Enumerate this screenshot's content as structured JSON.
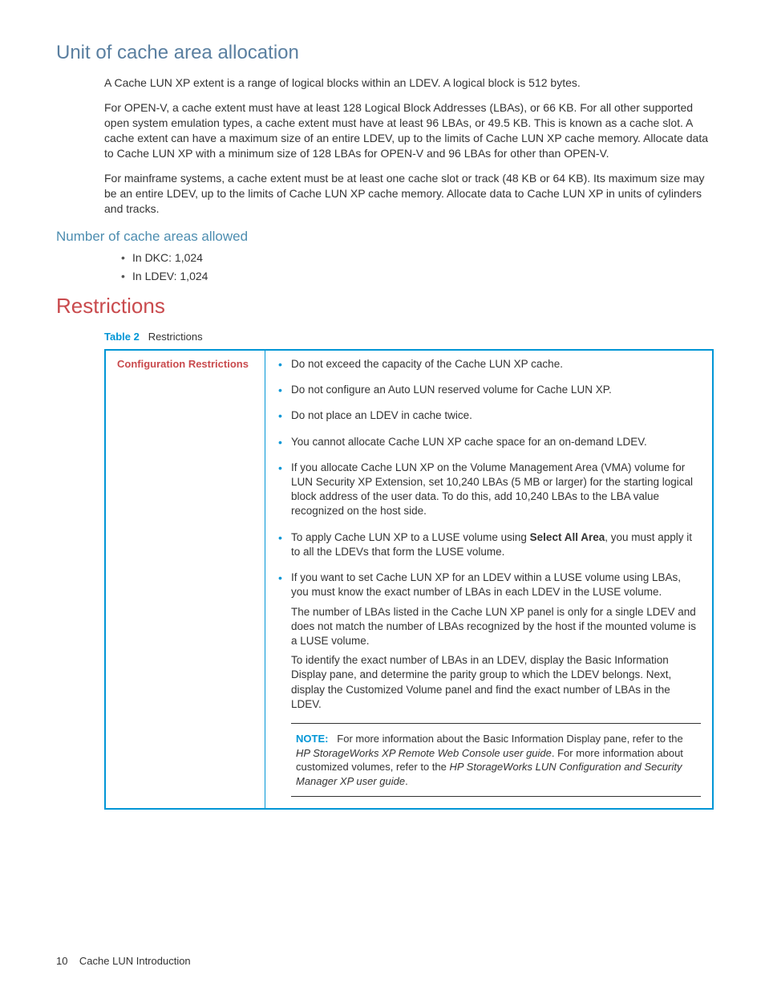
{
  "heading1": "Unit of cache area allocation",
  "para1": "A Cache LUN XP extent is a range of logical blocks within an LDEV. A logical block is 512 bytes.",
  "para2": "For OPEN-V, a cache extent must have at least 128 Logical Block Addresses (LBAs), or 66 KB. For all other supported open system emulation types, a cache extent must have at least 96 LBAs, or 49.5 KB. This is known as a cache slot. A cache extent can have a maximum size of an entire LDEV, up to the limits of Cache LUN XP cache memory. Allocate data to Cache LUN XP with a minimum size of 128 LBAs for OPEN-V and 96 LBAs for other than OPEN-V.",
  "para3": "For mainframe systems, a cache extent must be at least one cache slot or track (48 KB or 64 KB). Its maximum size may be an entire LDEV, up to the limits of Cache LUN XP cache memory. Allocate data to Cache LUN XP in units of cylinders and tracks.",
  "subheading1": "Number of cache areas allowed",
  "counts": {
    "dkc": "In DKC: 1,024",
    "ldev": "In LDEV: 1,024"
  },
  "heading2": "Restrictions",
  "table": {
    "label": "Table 2",
    "title": "Restrictions",
    "left_header": "Configuration Restrictions",
    "items": [
      {
        "text": "Do not exceed the capacity of the Cache LUN XP cache."
      },
      {
        "text": "Do not configure an Auto LUN reserved volume for Cache LUN XP."
      },
      {
        "text": "Do not place an LDEV in cache twice."
      },
      {
        "text": "You cannot allocate Cache LUN XP cache space for an on-demand LDEV."
      },
      {
        "text": "If you allocate Cache LUN XP on the Volume Management Area (VMA) volume for LUN Security XP Extension, set 10,240 LBAs (5 MB or larger) for the starting logical block address of the user data. To do this, add 10,240 LBAs to the LBA value recognized on the host side."
      },
      {
        "pre": "To apply Cache LUN XP to a LUSE volume using ",
        "bold": "Select All Area",
        "post": ", you must apply it to all the LDEVs that form the LUSE volume."
      },
      {
        "text": "If you want to set Cache LUN XP for an LDEV within a LUSE volume using LBAs, you must know the exact number of LBAs in each LDEV in the LUSE volume.",
        "p1": "The number of LBAs listed in the Cache LUN XP panel is only for a single LDEV and does not match the number of LBAs recognized by the host if the mounted volume is a LUSE volume.",
        "p2": "To identify the exact number of LBAs in an LDEV, display the Basic Information Display pane, and determine the parity group to which the LDEV belongs. Next, display the Customized Volume panel and find the exact number of LBAs in the LDEV."
      }
    ],
    "note": {
      "label": "NOTE:",
      "t1": "For more information about the Basic Information Display pane, refer to the ",
      "i1": "HP StorageWorks XP Remote Web Console user guide",
      "t2": ". For more information about customized volumes, refer to the ",
      "i2": "HP StorageWorks LUN Configuration and Security Manager XP user guide",
      "t3": "."
    }
  },
  "footer": {
    "page": "10",
    "section": "Cache LUN Introduction"
  }
}
